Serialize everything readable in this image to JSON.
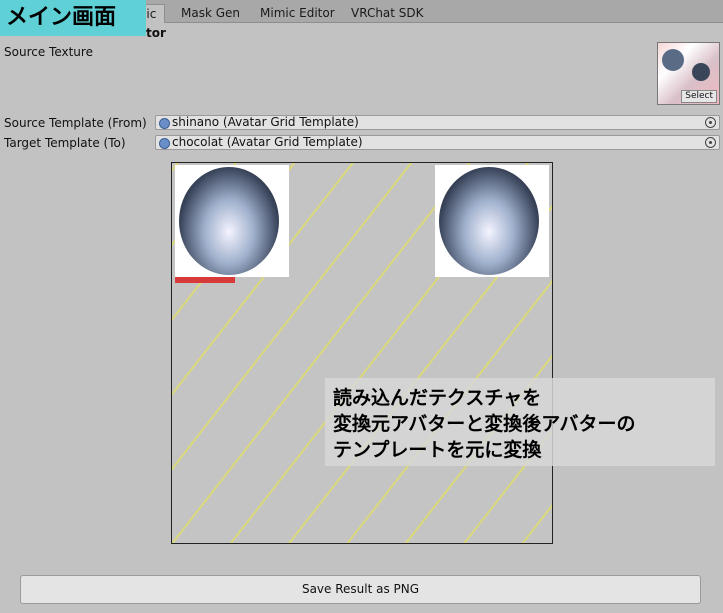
{
  "tabs": [
    "Mimic",
    "Mask Gen",
    "Mimic Editor",
    "VRChat SDK"
  ],
  "badge": "メイン画面",
  "heading_fragment": "tor",
  "source_texture": {
    "label": "Source Texture",
    "select_label": "Select"
  },
  "source_template": {
    "label": "Source Template (From)",
    "value": "shinano (Avatar Grid Template)"
  },
  "target_template": {
    "label": "Target Template (To)",
    "value": "chocolat (Avatar Grid Template)"
  },
  "overlay": {
    "line1": "読み込んだテクスチャを",
    "line2": "変換元アバターと変換後アバターの",
    "line3": "テンプレートを元に変換"
  },
  "save_button": "Save Result as PNG",
  "icons": {
    "object": "object-field-icon",
    "picker": "object-picker-icon"
  }
}
